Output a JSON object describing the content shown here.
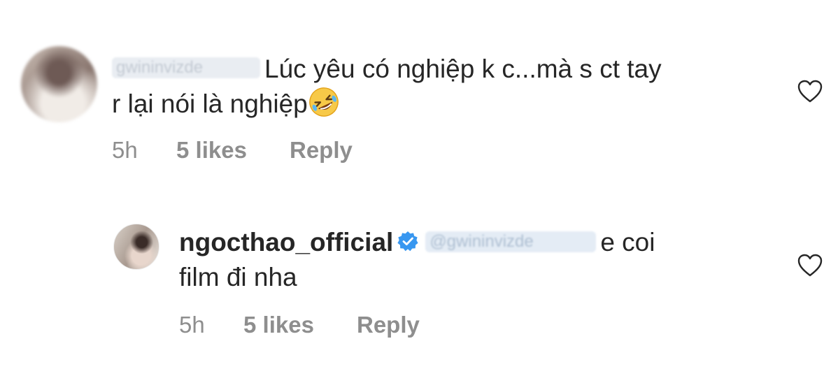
{
  "comment": {
    "username": "gwininvizde",
    "text_line1": "Lúc yêu có nghiệp k c...mà s ct tay",
    "text_line2": "r lại nói là nghiệp",
    "emoji": "rofl-emoji",
    "time": "5h",
    "likes": "5 likes",
    "reply": "Reply"
  },
  "reply_comment": {
    "username": "ngocthao_official",
    "verified": true,
    "mention": "@gwininvizde",
    "text_line1": "e coi",
    "text_line2": "film đi nha",
    "time": "5h",
    "likes": "5 likes",
    "reply": "Reply"
  },
  "colors": {
    "text": "#262626",
    "muted": "#8e8e8e",
    "verified": "#3897f0"
  },
  "icons": {
    "like": "heart-outline-icon",
    "verified": "verified-badge-icon"
  }
}
